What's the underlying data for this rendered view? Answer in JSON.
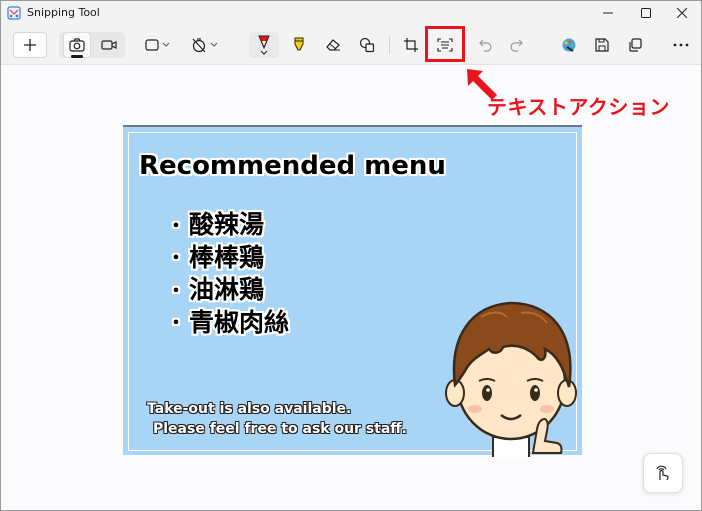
{
  "window": {
    "title": "Snipping Tool"
  },
  "toolbar": {
    "new_label": "+",
    "tools": [
      {
        "name": "new",
        "icon": "plus-icon"
      },
      {
        "name": "photo-mode",
        "icon": "camera-icon",
        "selected": true
      },
      {
        "name": "video-mode",
        "icon": "video-camera-icon"
      },
      {
        "name": "snip-shape",
        "icon": "rectangle-snip-icon"
      },
      {
        "name": "delay",
        "icon": "timer-off-icon"
      },
      {
        "name": "ballpoint-pen",
        "icon": "pen-icon",
        "color": "#e8141b"
      },
      {
        "name": "highlighter",
        "icon": "highlighter-icon",
        "color": "#f5d000"
      },
      {
        "name": "eraser",
        "icon": "eraser-icon"
      },
      {
        "name": "shapes",
        "icon": "shapes-icon"
      },
      {
        "name": "crop",
        "icon": "crop-icon"
      },
      {
        "name": "text-actions",
        "icon": "text-actions-icon"
      },
      {
        "name": "undo",
        "icon": "undo-icon"
      },
      {
        "name": "redo",
        "icon": "redo-icon"
      },
      {
        "name": "edit-in-paint",
        "icon": "paint-icon"
      },
      {
        "name": "save",
        "icon": "save-icon"
      },
      {
        "name": "copy",
        "icon": "copy-icon"
      },
      {
        "name": "more",
        "icon": "more-icon"
      }
    ]
  },
  "annotation": {
    "label": "テキストアクション",
    "color": "#e8141b"
  },
  "screenshot": {
    "title": "Recommended menu",
    "bullet": "・",
    "menu_items": [
      "酸辣湯",
      "棒棒鶏",
      "油淋鶏",
      "青椒肉絲"
    ],
    "note_line1": "Take-out is also available.",
    "note_line2": "Please feel free to ask our staff.",
    "background": "#a8d4f5"
  },
  "fab": {
    "icon": "touch-gesture-icon"
  }
}
